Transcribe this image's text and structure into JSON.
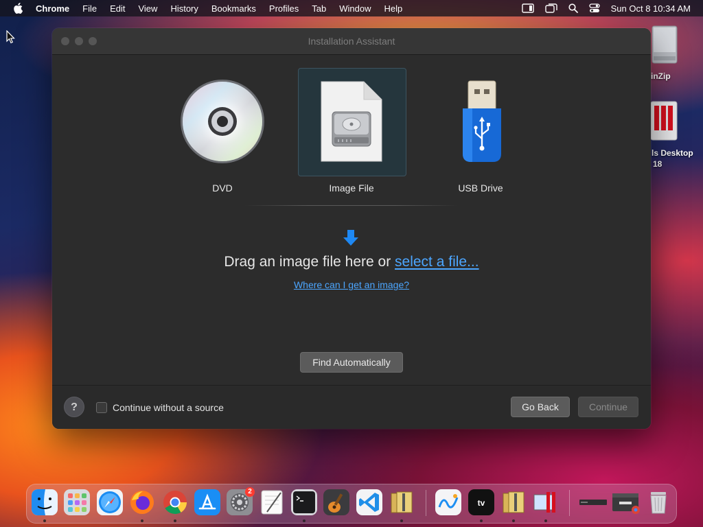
{
  "menubar": {
    "app_name": "Chrome",
    "items": [
      "File",
      "Edit",
      "View",
      "History",
      "Bookmarks",
      "Profiles",
      "Tab",
      "Window",
      "Help"
    ],
    "clock": "Sun Oct 8  10:34 AM",
    "status_icons": [
      "display-icon",
      "screen-mirror-icon",
      "spotlight-search-icon",
      "control-center-icon"
    ]
  },
  "desktop": {
    "icons": [
      {
        "label": "inZip",
        "icon": "winzip-disk-icon"
      },
      {
        "label_line1": "ls Desktop",
        "label_line2": "18",
        "icon": "parallels-desktop-icon"
      }
    ]
  },
  "window": {
    "title": "Installation Assistant",
    "sources": [
      {
        "label": "DVD",
        "icon": "dvd-icon",
        "selected": false
      },
      {
        "label": "Image File",
        "icon": "disk-image-file-icon",
        "selected": true
      },
      {
        "label": "USB Drive",
        "icon": "usb-drive-icon",
        "selected": false
      }
    ],
    "drop_prompt": "Drag an image file here or ",
    "select_file_link": "select a file...",
    "where_link": "Where can I get an image?",
    "find_button": "Find Automatically",
    "help_label": "?",
    "continue_without_source": "Continue without a source",
    "continue_without_source_checked": false,
    "go_back_button": "Go Back",
    "continue_button": "Continue",
    "continue_enabled": false
  },
  "dock": {
    "apps": [
      "Finder",
      "Launchpad",
      "Safari",
      "Firefox",
      "Google Chrome",
      "App Store",
      "System Settings",
      "TextEdit",
      "Terminal",
      "GarageBand",
      "Visual Studio Code",
      "Archive Utility",
      "Freeform",
      "Apple TV",
      "Archive Utility",
      "Parallels Desktop",
      "Window Thumbnail",
      "Chrome Window Thumbnail",
      "Trash"
    ],
    "system_settings_badge": "2",
    "accent": "#4ca6ff"
  }
}
